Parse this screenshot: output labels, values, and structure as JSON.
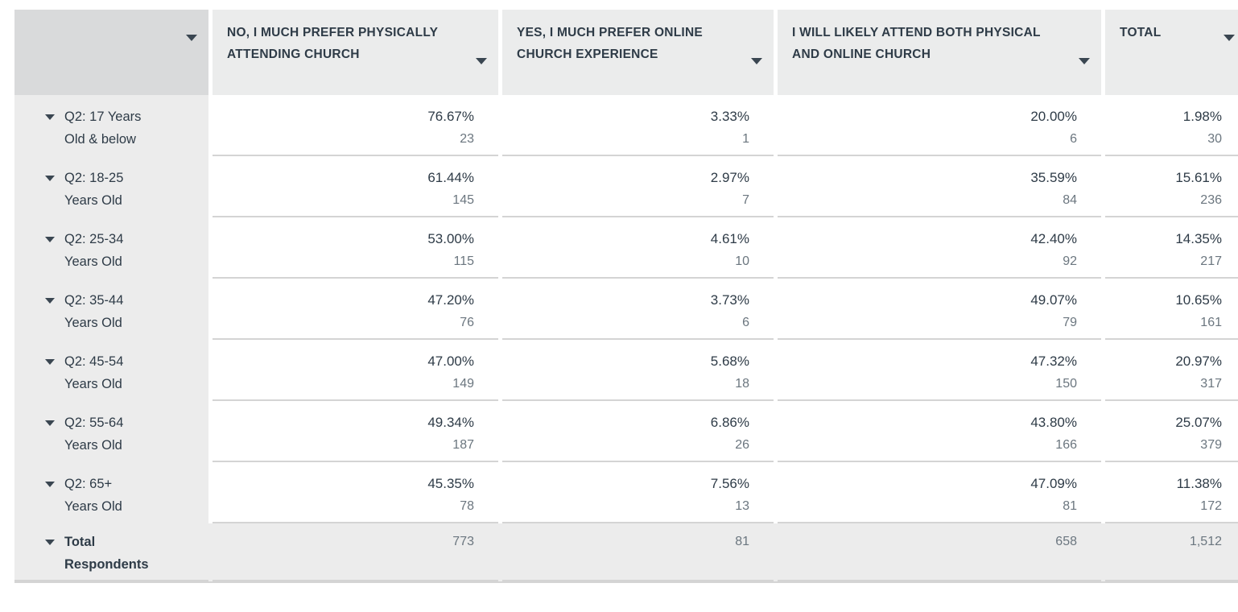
{
  "table": {
    "columns": [
      {
        "key": "label",
        "label": "",
        "has_filter": true
      },
      {
        "key": "no",
        "label": "NO, I MUCH PREFER PHYSICALLY ATTENDING CHURCH",
        "has_filter": true
      },
      {
        "key": "yes",
        "label": "YES, I MUCH PREFER ONLINE CHURCH EXPERIENCE",
        "has_filter": true
      },
      {
        "key": "both",
        "label": "I WILL LIKELY ATTEND BOTH PHYSICAL AND ONLINE CHURCH",
        "has_filter": true
      },
      {
        "key": "total",
        "label": "TOTAL",
        "has_filter": true
      }
    ],
    "rows": [
      {
        "label_line1": "Q2: 17 Years",
        "label_line2": "Old & below",
        "cells": [
          {
            "pct": "76.67%",
            "count": "23"
          },
          {
            "pct": "3.33%",
            "count": "1"
          },
          {
            "pct": "20.00%",
            "count": "6"
          },
          {
            "pct": "1.98%",
            "count": "30"
          }
        ]
      },
      {
        "label_line1": "Q2: 18-25",
        "label_line2": "Years Old",
        "cells": [
          {
            "pct": "61.44%",
            "count": "145"
          },
          {
            "pct": "2.97%",
            "count": "7"
          },
          {
            "pct": "35.59%",
            "count": "84"
          },
          {
            "pct": "15.61%",
            "count": "236"
          }
        ]
      },
      {
        "label_line1": "Q2: 25-34",
        "label_line2": "Years Old",
        "cells": [
          {
            "pct": "53.00%",
            "count": "115"
          },
          {
            "pct": "4.61%",
            "count": "10"
          },
          {
            "pct": "42.40%",
            "count": "92"
          },
          {
            "pct": "14.35%",
            "count": "217"
          }
        ]
      },
      {
        "label_line1": "Q2: 35-44",
        "label_line2": "Years Old",
        "cells": [
          {
            "pct": "47.20%",
            "count": "76"
          },
          {
            "pct": "3.73%",
            "count": "6"
          },
          {
            "pct": "49.07%",
            "count": "79"
          },
          {
            "pct": "10.65%",
            "count": "161"
          }
        ]
      },
      {
        "label_line1": "Q2: 45-54",
        "label_line2": "Years Old",
        "cells": [
          {
            "pct": "47.00%",
            "count": "149"
          },
          {
            "pct": "5.68%",
            "count": "18"
          },
          {
            "pct": "47.32%",
            "count": "150"
          },
          {
            "pct": "20.97%",
            "count": "317"
          }
        ]
      },
      {
        "label_line1": "Q2: 55-64",
        "label_line2": "Years Old",
        "cells": [
          {
            "pct": "49.34%",
            "count": "187"
          },
          {
            "pct": "6.86%",
            "count": "26"
          },
          {
            "pct": "43.80%",
            "count": "166"
          },
          {
            "pct": "25.07%",
            "count": "379"
          }
        ]
      },
      {
        "label_line1": "Q2: 65+",
        "label_line2": "Years Old",
        "cells": [
          {
            "pct": "45.35%",
            "count": "78"
          },
          {
            "pct": "7.56%",
            "count": "13"
          },
          {
            "pct": "47.09%",
            "count": "81"
          },
          {
            "pct": "11.38%",
            "count": "172"
          }
        ]
      }
    ],
    "totals_row": {
      "label_line1": "Total",
      "label_line2": "Respondents",
      "cells": [
        {
          "count": "773"
        },
        {
          "count": "81"
        },
        {
          "count": "658"
        },
        {
          "count": "1,512"
        }
      ]
    }
  },
  "chart_data": {
    "type": "table",
    "title": "",
    "categories": [
      "Q2: 17 Years Old & below",
      "Q2: 18-25 Years Old",
      "Q2: 25-34 Years Old",
      "Q2: 35-44 Years Old",
      "Q2: 45-54 Years Old",
      "Q2: 55-64 Years Old",
      "Q2: 65+ Years Old"
    ],
    "series": [
      {
        "name": "NO, I MUCH PREFER PHYSICALLY ATTENDING CHURCH",
        "percent": [
          76.67,
          61.44,
          53.0,
          47.2,
          47.0,
          49.34,
          45.35
        ],
        "counts": [
          23,
          145,
          115,
          76,
          149,
          187,
          78
        ],
        "total_count": 773
      },
      {
        "name": "YES, I MUCH PREFER ONLINE CHURCH EXPERIENCE",
        "percent": [
          3.33,
          2.97,
          4.61,
          3.73,
          5.68,
          6.86,
          7.56
        ],
        "counts": [
          1,
          7,
          10,
          6,
          18,
          26,
          13
        ],
        "total_count": 81
      },
      {
        "name": "I WILL LIKELY ATTEND BOTH PHYSICAL AND ONLINE CHURCH",
        "percent": [
          20.0,
          35.59,
          42.4,
          49.07,
          47.32,
          43.8,
          47.09
        ],
        "counts": [
          6,
          84,
          92,
          79,
          150,
          166,
          81
        ],
        "total_count": 658
      },
      {
        "name": "TOTAL",
        "percent": [
          1.98,
          15.61,
          14.35,
          10.65,
          20.97,
          25.07,
          11.38
        ],
        "counts": [
          30,
          236,
          217,
          161,
          317,
          379,
          172
        ],
        "total_count": 1512
      }
    ]
  }
}
